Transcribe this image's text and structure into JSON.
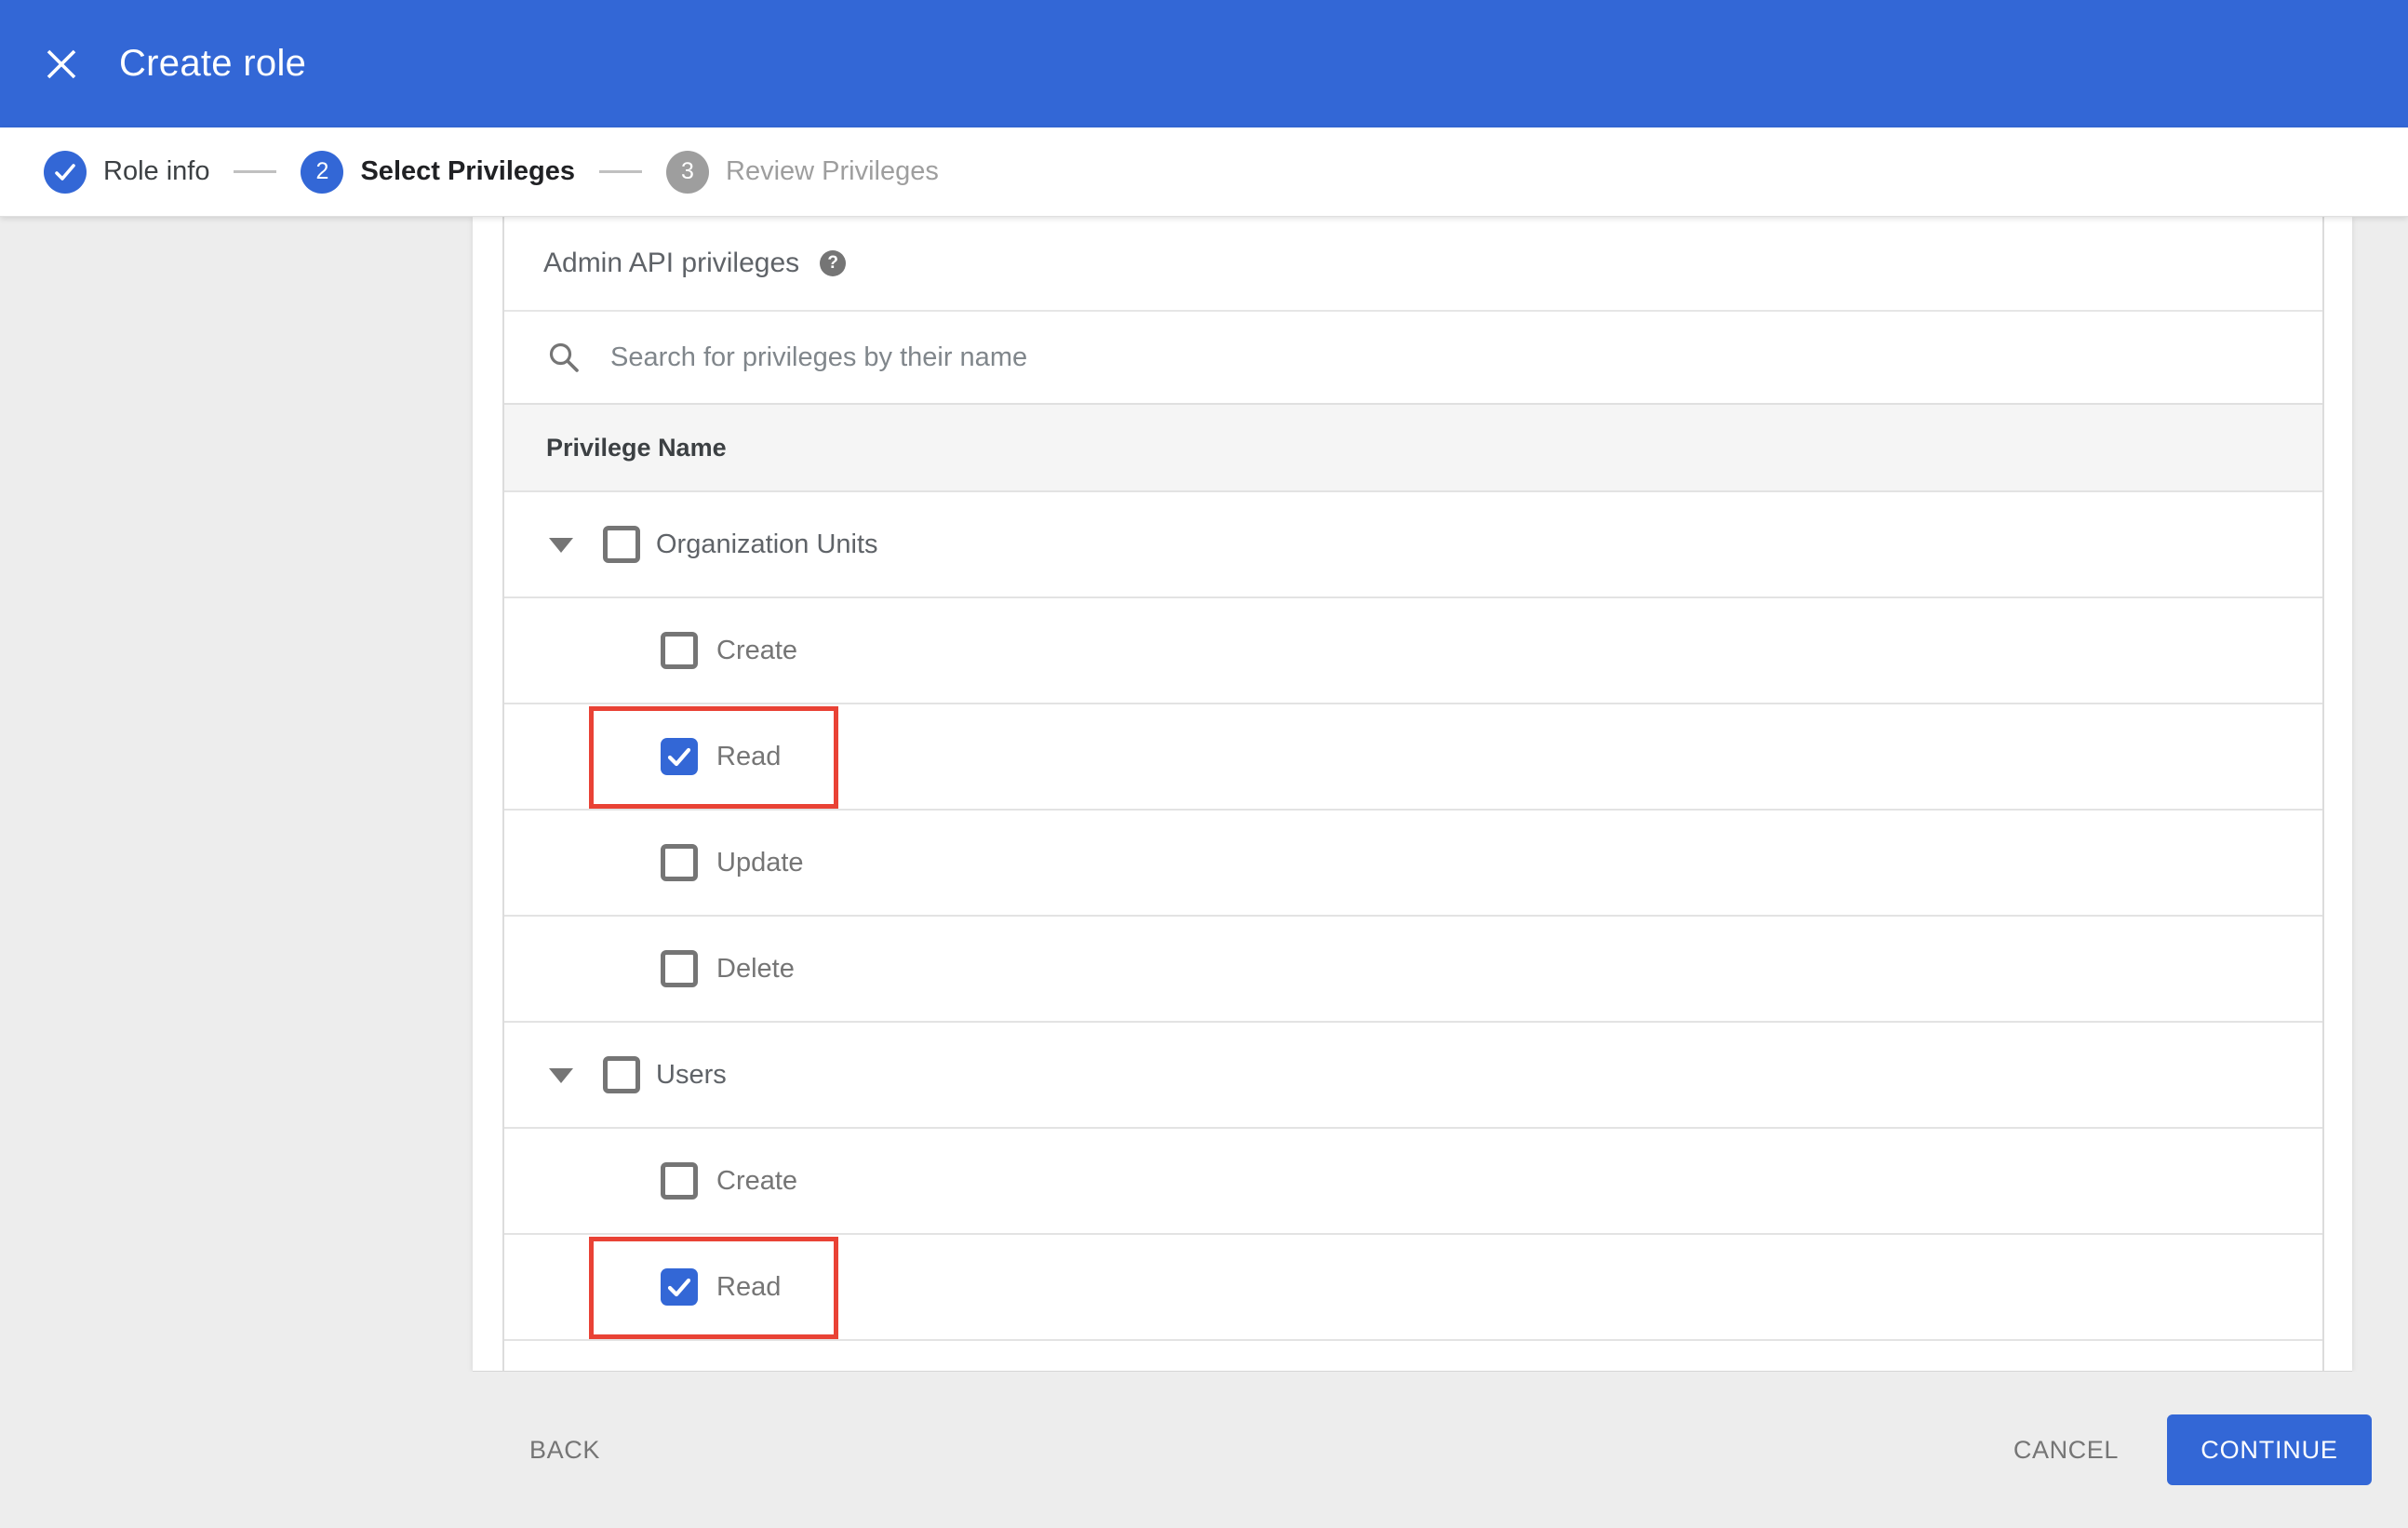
{
  "header": {
    "title": "Create role"
  },
  "stepper": {
    "steps": [
      {
        "indicator": "check",
        "label": "Role info",
        "state": "completed"
      },
      {
        "indicator": "2",
        "label": "Select Privileges",
        "state": "active"
      },
      {
        "indicator": "3",
        "label": "Review Privileges",
        "state": "upcoming"
      }
    ]
  },
  "content": {
    "section_title": "Admin API privileges",
    "search": {
      "placeholder": "Search for privileges by their name",
      "value": ""
    },
    "table": {
      "header": "Privilege Name",
      "rows": [
        {
          "label": "Organization Units",
          "level": "parent",
          "expanded": true,
          "checked": false,
          "highlighted": false
        },
        {
          "label": "Create",
          "level": "child",
          "checked": false,
          "highlighted": false
        },
        {
          "label": "Read",
          "level": "child",
          "checked": true,
          "highlighted": true
        },
        {
          "label": "Update",
          "level": "child",
          "checked": false,
          "highlighted": false
        },
        {
          "label": "Delete",
          "level": "child",
          "checked": false,
          "highlighted": false
        },
        {
          "label": "Users",
          "level": "parent",
          "expanded": true,
          "checked": false,
          "highlighted": false
        },
        {
          "label": "Create",
          "level": "child",
          "checked": false,
          "highlighted": false
        },
        {
          "label": "Read",
          "level": "child",
          "checked": true,
          "highlighted": true
        }
      ]
    }
  },
  "footer": {
    "back_label": "BACK",
    "cancel_label": "CANCEL",
    "continue_label": "CONTINUE"
  },
  "colors": {
    "primary_blue": "#3367d6",
    "highlight_red": "#e94235",
    "page_gray": "#ededed",
    "table_header_gray": "#f5f5f5"
  }
}
